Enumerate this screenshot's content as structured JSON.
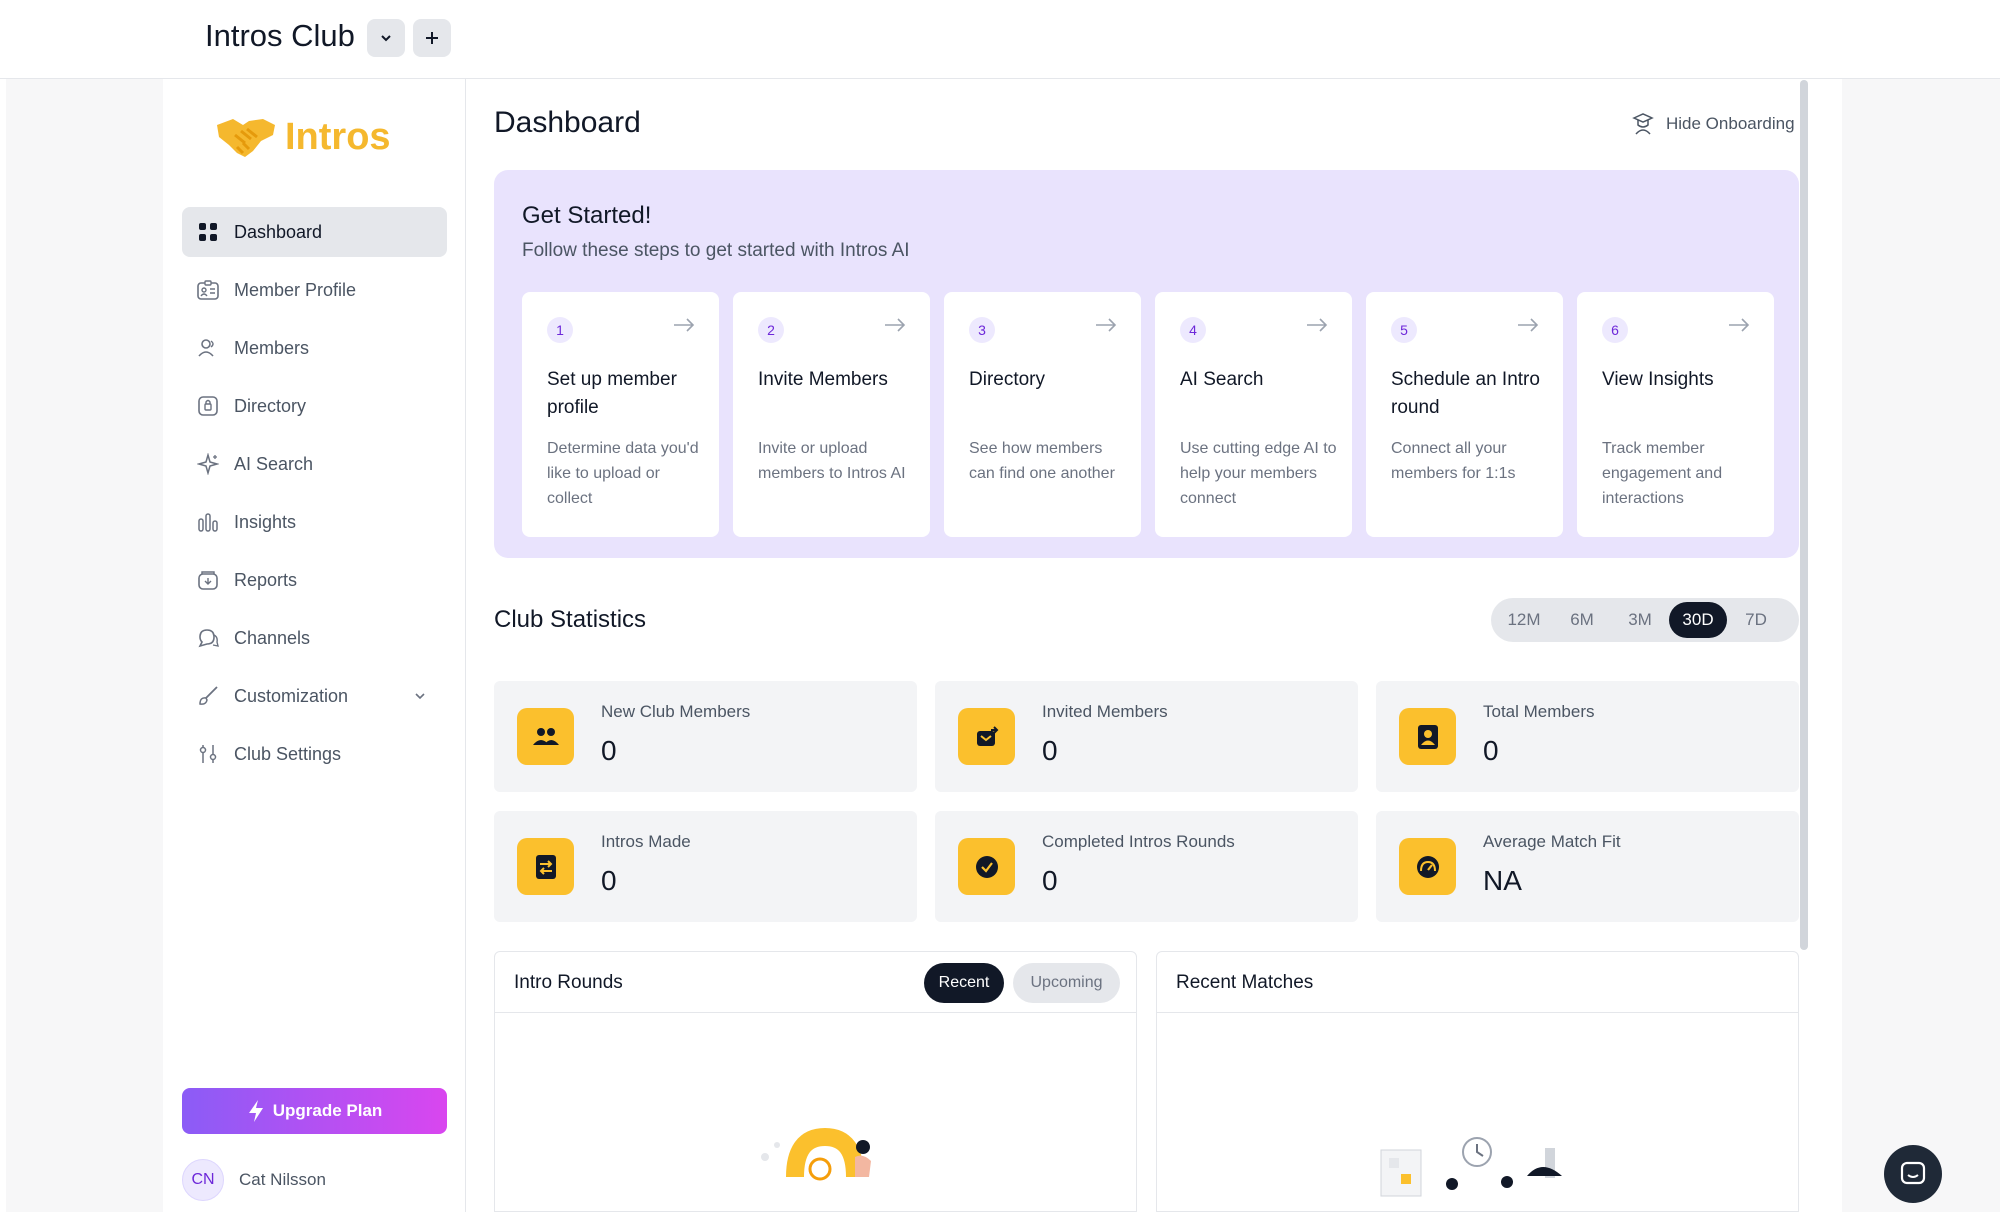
{
  "topbar": {
    "club_title": "Intros Club",
    "dropdown_icon": "chevron-down-icon",
    "add_icon": "plus-icon"
  },
  "sidebar": {
    "logo_text": "Intros",
    "items": [
      {
        "label": "Dashboard",
        "icon": "grid-icon",
        "active": true
      },
      {
        "label": "Member Profile",
        "icon": "id-card-icon"
      },
      {
        "label": "Members",
        "icon": "users-icon"
      },
      {
        "label": "Directory",
        "icon": "directory-icon"
      },
      {
        "label": "AI Search",
        "icon": "sparkle-icon"
      },
      {
        "label": "Insights",
        "icon": "bar-chart-icon"
      },
      {
        "label": "Reports",
        "icon": "report-icon"
      },
      {
        "label": "Channels",
        "icon": "chat-bubbles-icon"
      },
      {
        "label": "Customization",
        "icon": "brush-icon"
      },
      {
        "label": "Club Settings",
        "icon": "sliders-icon"
      }
    ],
    "upgrade_label": "Upgrade Plan",
    "user": {
      "initials": "CN",
      "name": "Cat Nilsson"
    }
  },
  "main": {
    "title": "Dashboard",
    "hide_onboarding": "Hide Onboarding",
    "onboarding": {
      "title": "Get Started!",
      "subtitle": "Follow these steps to get started with Intros AI",
      "steps": [
        {
          "num": "1",
          "title": "Set up member profile",
          "desc": "Determine data you'd like to upload or collect"
        },
        {
          "num": "2",
          "title": "Invite Members",
          "desc": "Invite or upload members to Intros AI"
        },
        {
          "num": "3",
          "title": "Directory",
          "desc": "See how members can find one another"
        },
        {
          "num": "4",
          "title": "AI Search",
          "desc": "Use cutting edge AI to help your members connect"
        },
        {
          "num": "5",
          "title": "Schedule an Intro round",
          "desc": "Connect all your members for 1:1s"
        },
        {
          "num": "6",
          "title": "View Insights",
          "desc": "Track member engagement and interactions"
        }
      ]
    },
    "stats": {
      "title": "Club Statistics",
      "ranges": [
        "12M",
        "6M",
        "3M",
        "30D",
        "7D"
      ],
      "active_range": "30D",
      "cards": [
        {
          "label": "New Club Members",
          "value": "0",
          "icon": "group-icon"
        },
        {
          "label": "Invited Members",
          "value": "0",
          "icon": "invite-icon"
        },
        {
          "label": "Total Members",
          "value": "0",
          "icon": "contact-icon"
        },
        {
          "label": "Intros Made",
          "value": "0",
          "icon": "swap-icon"
        },
        {
          "label": "Completed Intros Rounds",
          "value": "0",
          "icon": "check-circle-icon"
        },
        {
          "label": "Average Match Fit",
          "value": "NA",
          "icon": "gauge-icon"
        }
      ]
    },
    "intro_rounds": {
      "title": "Intro Rounds",
      "tab_recent": "Recent",
      "tab_upcoming": "Upcoming"
    },
    "recent_matches": {
      "title": "Recent Matches"
    }
  },
  "colors": {
    "accent_yellow": "#fbc02d",
    "onboarding_bg": "#e9e3fd",
    "upgrade_from": "#8b5cf6",
    "upgrade_to": "#d946ef",
    "dark": "#111827"
  }
}
